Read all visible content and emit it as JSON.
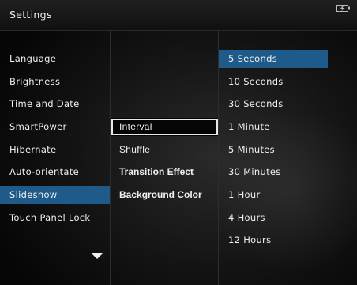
{
  "header": {
    "title": "Settings",
    "status_icon": "battery-power-icon"
  },
  "settings_menu": {
    "items": [
      {
        "label": "Language"
      },
      {
        "label": "Brightness"
      },
      {
        "label": "Time and Date"
      },
      {
        "label": "SmartPower"
      },
      {
        "label": "Hibernate"
      },
      {
        "label": "Auto-orientate"
      },
      {
        "label": "Slideshow",
        "selected": true
      },
      {
        "label": "Touch Panel Lock"
      }
    ],
    "scroll_icon": "chevron-down-icon"
  },
  "slideshow_menu": {
    "items": [
      {
        "label": "Interval",
        "focused": true
      },
      {
        "label": "Shuffle"
      },
      {
        "label": "Transition Effect"
      },
      {
        "label": "Background Color"
      }
    ]
  },
  "interval_options": {
    "items": [
      {
        "label": "5 Seconds",
        "selected": true
      },
      {
        "label": "10 Seconds"
      },
      {
        "label": "30 Seconds"
      },
      {
        "label": "1 Minute"
      },
      {
        "label": "5 Minutes"
      },
      {
        "label": "30 Minutes"
      },
      {
        "label": "1 Hour"
      },
      {
        "label": "4 Hours"
      },
      {
        "label": "12 Hours"
      }
    ]
  },
  "colors": {
    "selection": "#1e5a8a",
    "background": "#0a0a0a",
    "text": "#f0f0f0"
  }
}
